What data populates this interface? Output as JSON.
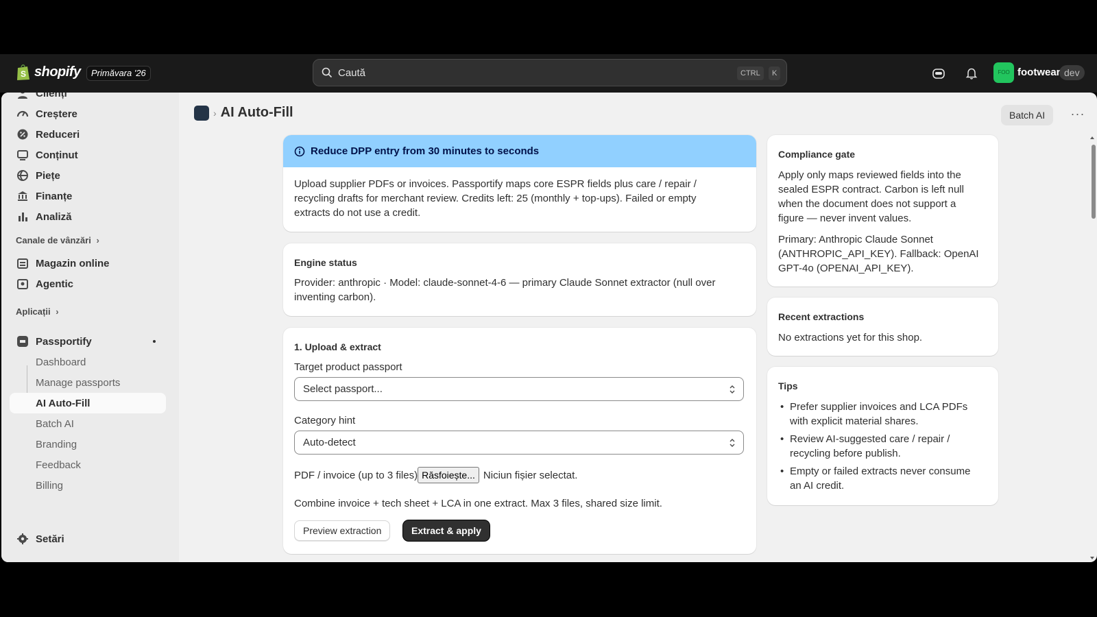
{
  "topbar": {
    "brand": "shopify",
    "season": "Primăvara '26",
    "search_placeholder": "Caută",
    "kbd_ctrl": "CTRL",
    "kbd_k": "K",
    "store_avatar": "FOO",
    "store_name": "footwear",
    "store_badge": "dev"
  },
  "sidebar": {
    "items": [
      {
        "label": "Clienți",
        "icon": "person-icon"
      },
      {
        "label": "Creștere",
        "icon": "gauge-icon"
      },
      {
        "label": "Reduceri",
        "icon": "discount-icon"
      },
      {
        "label": "Conținut",
        "icon": "content-icon"
      },
      {
        "label": "Piețe",
        "icon": "globe-icon"
      },
      {
        "label": "Finanțe",
        "icon": "bank-icon"
      },
      {
        "label": "Analiză",
        "icon": "bar-chart-icon"
      }
    ],
    "sales_channels_label": "Canale de vânzări",
    "channels": [
      {
        "label": "Magazin online",
        "icon": "store-icon"
      },
      {
        "label": "Agentic",
        "icon": "agentic-icon"
      }
    ],
    "apps_label": "Aplicații",
    "app_name": "Passportify",
    "app_sub_items": [
      "Dashboard",
      "Manage passports",
      "AI Auto-Fill",
      "Batch AI",
      "Branding",
      "Feedback",
      "Billing"
    ],
    "active_sub_item": "AI Auto-Fill",
    "settings_label": "Setări"
  },
  "page": {
    "title": "AI Auto-Fill",
    "batch_button": "Batch AI",
    "more_button": "···"
  },
  "banner": {
    "title": "Reduce DPP entry from 30 minutes to seconds",
    "body": "Upload supplier PDFs or invoices. Passportify maps core ESPR fields plus care / repair / recycling drafts for merchant review. Credits left: 25 (monthly + top-ups). Failed or empty extracts do not use a credit."
  },
  "engine": {
    "title": "Engine status",
    "body": "Provider: anthropic · Model: claude-sonnet-4-6 — primary Claude Sonnet extractor (null over inventing carbon)."
  },
  "upload": {
    "title": "1. Upload & extract",
    "target_label": "Target product passport",
    "target_value": "Select passport...",
    "category_label": "Category hint",
    "category_value": "Auto-detect",
    "file_label": "PDF / invoice (up to 3 files)",
    "file_button": "Răsfoiește...",
    "file_status": "Niciun fișier selectat.",
    "help": "Combine invoice + tech sheet + LCA in one extract. Max 3 files, shared size limit.",
    "preview_button": "Preview extraction",
    "apply_button": "Extract & apply"
  },
  "compliance": {
    "title": "Compliance gate",
    "p1": "Apply only maps reviewed fields into the sealed ESPR contract. Carbon is left null when the document does not support a figure — never invent values.",
    "p2": "Primary: Anthropic Claude Sonnet (ANTHROPIC_API_KEY). Fallback: OpenAI GPT-4o (OPENAI_API_KEY)."
  },
  "recent": {
    "title": "Recent extractions",
    "empty": "No extractions yet for this shop."
  },
  "tips": {
    "title": "Tips",
    "items": [
      "Prefer supplier invoices and LCA PDFs with explicit material shares.",
      "Review AI-suggested care / repair / recycling before publish.",
      "Empty or failed extracts never consume an AI credit."
    ]
  },
  "colors": {
    "banner_bg": "#91d0ff",
    "topbar_bg": "#1a1a1a",
    "primary_button": "#303030",
    "store_avatar_bg": "#22c55e"
  }
}
